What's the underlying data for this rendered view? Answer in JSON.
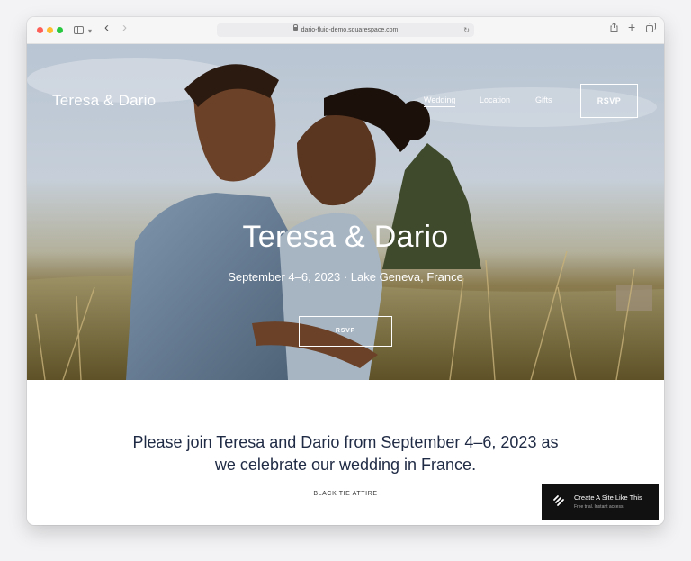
{
  "browser": {
    "url": "dario-fluid-demo.squarespace.com"
  },
  "site": {
    "title": "Teresa & Dario",
    "nav": [
      "Wedding",
      "Location",
      "Gifts"
    ],
    "rsvp_button": "RSVP"
  },
  "hero": {
    "heading": "Teresa & Dario",
    "subheading": "September 4–6, 2023 · Lake Geneva, France",
    "rsvp_button": "RSVP"
  },
  "intro": {
    "line1": "Please join Teresa and Dario from September 4–6, 2023 as",
    "line2": "we celebrate our wedding in France.",
    "attire": "BLACK TIE ATTIRE"
  },
  "badge": {
    "title": "Create A Site Like This",
    "subtitle": "Free trial. Instant access."
  },
  "colors": {
    "text_dark": "#1f2a44",
    "badge_bg": "#111111"
  }
}
